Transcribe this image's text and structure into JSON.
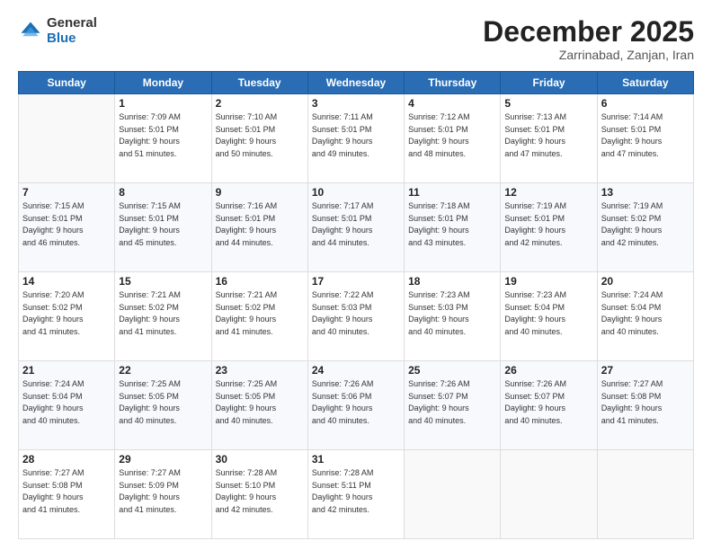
{
  "logo": {
    "general": "General",
    "blue": "Blue"
  },
  "header": {
    "month": "December 2025",
    "location": "Zarrinabad, Zanjan, Iran"
  },
  "weekdays": [
    "Sunday",
    "Monday",
    "Tuesday",
    "Wednesday",
    "Thursday",
    "Friday",
    "Saturday"
  ],
  "weeks": [
    [
      {
        "day": "",
        "sunrise": "",
        "sunset": "",
        "daylight": ""
      },
      {
        "day": "1",
        "sunrise": "Sunrise: 7:09 AM",
        "sunset": "Sunset: 5:01 PM",
        "daylight": "Daylight: 9 hours and 51 minutes."
      },
      {
        "day": "2",
        "sunrise": "Sunrise: 7:10 AM",
        "sunset": "Sunset: 5:01 PM",
        "daylight": "Daylight: 9 hours and 50 minutes."
      },
      {
        "day": "3",
        "sunrise": "Sunrise: 7:11 AM",
        "sunset": "Sunset: 5:01 PM",
        "daylight": "Daylight: 9 hours and 49 minutes."
      },
      {
        "day": "4",
        "sunrise": "Sunrise: 7:12 AM",
        "sunset": "Sunset: 5:01 PM",
        "daylight": "Daylight: 9 hours and 48 minutes."
      },
      {
        "day": "5",
        "sunrise": "Sunrise: 7:13 AM",
        "sunset": "Sunset: 5:01 PM",
        "daylight": "Daylight: 9 hours and 47 minutes."
      },
      {
        "day": "6",
        "sunrise": "Sunrise: 7:14 AM",
        "sunset": "Sunset: 5:01 PM",
        "daylight": "Daylight: 9 hours and 47 minutes."
      }
    ],
    [
      {
        "day": "7",
        "sunrise": "Sunrise: 7:15 AM",
        "sunset": "Sunset: 5:01 PM",
        "daylight": "Daylight: 9 hours and 46 minutes."
      },
      {
        "day": "8",
        "sunrise": "Sunrise: 7:15 AM",
        "sunset": "Sunset: 5:01 PM",
        "daylight": "Daylight: 9 hours and 45 minutes."
      },
      {
        "day": "9",
        "sunrise": "Sunrise: 7:16 AM",
        "sunset": "Sunset: 5:01 PM",
        "daylight": "Daylight: 9 hours and 44 minutes."
      },
      {
        "day": "10",
        "sunrise": "Sunrise: 7:17 AM",
        "sunset": "Sunset: 5:01 PM",
        "daylight": "Daylight: 9 hours and 44 minutes."
      },
      {
        "day": "11",
        "sunrise": "Sunrise: 7:18 AM",
        "sunset": "Sunset: 5:01 PM",
        "daylight": "Daylight: 9 hours and 43 minutes."
      },
      {
        "day": "12",
        "sunrise": "Sunrise: 7:19 AM",
        "sunset": "Sunset: 5:01 PM",
        "daylight": "Daylight: 9 hours and 42 minutes."
      },
      {
        "day": "13",
        "sunrise": "Sunrise: 7:19 AM",
        "sunset": "Sunset: 5:02 PM",
        "daylight": "Daylight: 9 hours and 42 minutes."
      }
    ],
    [
      {
        "day": "14",
        "sunrise": "Sunrise: 7:20 AM",
        "sunset": "Sunset: 5:02 PM",
        "daylight": "Daylight: 9 hours and 41 minutes."
      },
      {
        "day": "15",
        "sunrise": "Sunrise: 7:21 AM",
        "sunset": "Sunset: 5:02 PM",
        "daylight": "Daylight: 9 hours and 41 minutes."
      },
      {
        "day": "16",
        "sunrise": "Sunrise: 7:21 AM",
        "sunset": "Sunset: 5:02 PM",
        "daylight": "Daylight: 9 hours and 41 minutes."
      },
      {
        "day": "17",
        "sunrise": "Sunrise: 7:22 AM",
        "sunset": "Sunset: 5:03 PM",
        "daylight": "Daylight: 9 hours and 40 minutes."
      },
      {
        "day": "18",
        "sunrise": "Sunrise: 7:23 AM",
        "sunset": "Sunset: 5:03 PM",
        "daylight": "Daylight: 9 hours and 40 minutes."
      },
      {
        "day": "19",
        "sunrise": "Sunrise: 7:23 AM",
        "sunset": "Sunset: 5:04 PM",
        "daylight": "Daylight: 9 hours and 40 minutes."
      },
      {
        "day": "20",
        "sunrise": "Sunrise: 7:24 AM",
        "sunset": "Sunset: 5:04 PM",
        "daylight": "Daylight: 9 hours and 40 minutes."
      }
    ],
    [
      {
        "day": "21",
        "sunrise": "Sunrise: 7:24 AM",
        "sunset": "Sunset: 5:04 PM",
        "daylight": "Daylight: 9 hours and 40 minutes."
      },
      {
        "day": "22",
        "sunrise": "Sunrise: 7:25 AM",
        "sunset": "Sunset: 5:05 PM",
        "daylight": "Daylight: 9 hours and 40 minutes."
      },
      {
        "day": "23",
        "sunrise": "Sunrise: 7:25 AM",
        "sunset": "Sunset: 5:05 PM",
        "daylight": "Daylight: 9 hours and 40 minutes."
      },
      {
        "day": "24",
        "sunrise": "Sunrise: 7:26 AM",
        "sunset": "Sunset: 5:06 PM",
        "daylight": "Daylight: 9 hours and 40 minutes."
      },
      {
        "day": "25",
        "sunrise": "Sunrise: 7:26 AM",
        "sunset": "Sunset: 5:07 PM",
        "daylight": "Daylight: 9 hours and 40 minutes."
      },
      {
        "day": "26",
        "sunrise": "Sunrise: 7:26 AM",
        "sunset": "Sunset: 5:07 PM",
        "daylight": "Daylight: 9 hours and 40 minutes."
      },
      {
        "day": "27",
        "sunrise": "Sunrise: 7:27 AM",
        "sunset": "Sunset: 5:08 PM",
        "daylight": "Daylight: 9 hours and 41 minutes."
      }
    ],
    [
      {
        "day": "28",
        "sunrise": "Sunrise: 7:27 AM",
        "sunset": "Sunset: 5:08 PM",
        "daylight": "Daylight: 9 hours and 41 minutes."
      },
      {
        "day": "29",
        "sunrise": "Sunrise: 7:27 AM",
        "sunset": "Sunset: 5:09 PM",
        "daylight": "Daylight: 9 hours and 41 minutes."
      },
      {
        "day": "30",
        "sunrise": "Sunrise: 7:28 AM",
        "sunset": "Sunset: 5:10 PM",
        "daylight": "Daylight: 9 hours and 42 minutes."
      },
      {
        "day": "31",
        "sunrise": "Sunrise: 7:28 AM",
        "sunset": "Sunset: 5:11 PM",
        "daylight": "Daylight: 9 hours and 42 minutes."
      },
      {
        "day": "",
        "sunrise": "",
        "sunset": "",
        "daylight": ""
      },
      {
        "day": "",
        "sunrise": "",
        "sunset": "",
        "daylight": ""
      },
      {
        "day": "",
        "sunrise": "",
        "sunset": "",
        "daylight": ""
      }
    ]
  ]
}
